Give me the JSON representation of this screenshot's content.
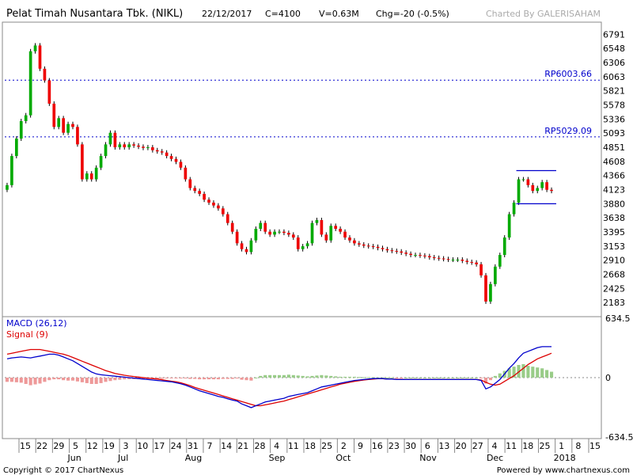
{
  "header": {
    "title": "Pelat Timah Nusantara Tbk. (NIKL)",
    "date": "22/12/2017",
    "close": "C=4100",
    "volume": "V=0.63M",
    "change": "Chg=-20 (-0.5%)",
    "charted_by": "Charted By GALERISAHAM"
  },
  "footer": {
    "copyright": "Copyright © 2017 ChartNexus",
    "powered_by": "Powered by www.chartnexus.com"
  },
  "colors": {
    "up": "#00aa00",
    "down": "#ee0000",
    "wick": "#000000",
    "macd_line": "#0000cc",
    "signal_line": "#dd0000",
    "hist_pos": "#99cc88",
    "hist_neg": "#ee9999",
    "level_line": "#0000cc",
    "box": "#0000cc",
    "grid_frame": "#888888"
  },
  "chart_data": [
    {
      "type": "candlestick",
      "title": "Pelat Timah Nusantara Tbk. (NIKL)",
      "y_ticks": [
        6791,
        6548,
        6306,
        6063,
        5821,
        5578,
        5336,
        5093,
        4851,
        4608,
        4366,
        4123,
        3880,
        3638,
        3395,
        3153,
        2910,
        2668,
        2425,
        2183
      ],
      "ylim": [
        1940,
        7000
      ],
      "x_ticks": [
        "15",
        "22",
        "29",
        "5",
        "12",
        "19",
        "3",
        "10",
        "17",
        "24",
        "31",
        "7",
        "14",
        "21",
        "28",
        "4",
        "11",
        "18",
        "25",
        "2",
        "9",
        "16",
        "23",
        "30",
        "6",
        "13",
        "20",
        "27",
        "4",
        "11",
        "18",
        "25",
        "1",
        "8",
        "15"
      ],
      "month_labels": [
        "Jun",
        "Jul",
        "Aug",
        "Sep",
        "Oct",
        "Nov",
        "Dec",
        "2018"
      ],
      "levels": [
        {
          "label": "RP6003.66",
          "value": 6003.66
        },
        {
          "label": "RP5029.09",
          "value": 5029.09
        }
      ],
      "range_box": {
        "high": 4450,
        "low": 3880
      },
      "close_series": [
        4200,
        4700,
        5000,
        5300,
        5400,
        6500,
        6600,
        6200,
        6000,
        5600,
        5200,
        5350,
        5100,
        5250,
        5200,
        4900,
        4300,
        4400,
        4300,
        4500,
        4700,
        4900,
        5100,
        4850,
        4900,
        4850,
        4900,
        4880,
        4860,
        4840,
        4850,
        4800,
        4780,
        4760,
        4700,
        4650,
        4600,
        4500,
        4300,
        4150,
        4100,
        4050,
        3950,
        3900,
        3850,
        3800,
        3700,
        3550,
        3400,
        3200,
        3100,
        3050,
        3250,
        3450,
        3550,
        3400,
        3350,
        3400,
        3400,
        3380,
        3350,
        3300,
        3100,
        3150,
        3200,
        3550,
        3600,
        3350,
        3250,
        3500,
        3450,
        3400,
        3300,
        3250,
        3200,
        3180,
        3160,
        3150,
        3140,
        3120,
        3100,
        3080,
        3070,
        3060,
        3040,
        3020,
        3000,
        3000,
        2990,
        2980,
        2960,
        2950,
        2940,
        2930,
        2920,
        2920,
        2920,
        2900,
        2880,
        2870,
        2840,
        2650,
        2200,
        2500,
        2800,
        3000,
        3300,
        3700,
        3900,
        4300,
        4300,
        4200,
        4100,
        4150,
        4250,
        4120,
        4100
      ],
      "macd": {
        "name": "MACD (26,12)",
        "ylim": [
          -650,
          650
        ],
        "y_ticks": [
          634.5,
          0,
          -634.5
        ],
        "values": [
          200,
          210,
          215,
          220,
          215,
          210,
          220,
          230,
          240,
          250,
          250,
          240,
          220,
          200,
          180,
          150,
          120,
          90,
          60,
          40,
          30,
          25,
          20,
          15,
          10,
          5,
          0,
          -5,
          -10,
          -15,
          -20,
          -25,
          -30,
          -35,
          -40,
          -45,
          -55,
          -65,
          -80,
          -100,
          -120,
          -140,
          -155,
          -170,
          -185,
          -200,
          -210,
          -225,
          -240,
          -250,
          -280,
          -300,
          -320,
          -300,
          -280,
          -260,
          -250,
          -240,
          -230,
          -220,
          -200,
          -190,
          -180,
          -170,
          -160,
          -140,
          -120,
          -100,
          -90,
          -80,
          -70,
          -60,
          -50,
          -40,
          -30,
          -25,
          -20,
          -15,
          -10,
          -10,
          -10,
          -15,
          -15,
          -20,
          -20,
          -20,
          -20,
          -20,
          -20,
          -20,
          -20,
          -20,
          -20,
          -20,
          -20,
          -20,
          -20,
          -20,
          -20,
          -20,
          -20,
          -30,
          -120,
          -100,
          -60,
          -20,
          40,
          100,
          150,
          210,
          260,
          280,
          300,
          320,
          330,
          330,
          330
        ]
      },
      "signal": {
        "name": "Signal (9)",
        "values": [
          250,
          260,
          270,
          280,
          290,
          300,
          300,
          300,
          290,
          280,
          270,
          260,
          250,
          235,
          215,
          195,
          175,
          155,
          135,
          115,
          95,
          75,
          60,
          45,
          35,
          25,
          18,
          12,
          6,
          0,
          -5,
          -10,
          -15,
          -22,
          -30,
          -38,
          -45,
          -55,
          -70,
          -85,
          -105,
          -120,
          -135,
          -150,
          -165,
          -180,
          -195,
          -210,
          -225,
          -240,
          -255,
          -270,
          -285,
          -300,
          -300,
          -290,
          -280,
          -270,
          -260,
          -250,
          -235,
          -220,
          -205,
          -190,
          -175,
          -160,
          -145,
          -130,
          -115,
          -100,
          -85,
          -70,
          -60,
          -50,
          -40,
          -32,
          -25,
          -20,
          -15,
          -12,
          -12,
          -15,
          -16,
          -18,
          -19,
          -20,
          -20,
          -20,
          -20,
          -20,
          -20,
          -20,
          -20,
          -20,
          -20,
          -20,
          -20,
          -20,
          -20,
          -20,
          -20,
          -25,
          -50,
          -70,
          -80,
          -70,
          -40,
          -10,
          20,
          60,
          100,
          140,
          170,
          200,
          220,
          240,
          260
        ]
      }
    }
  ]
}
